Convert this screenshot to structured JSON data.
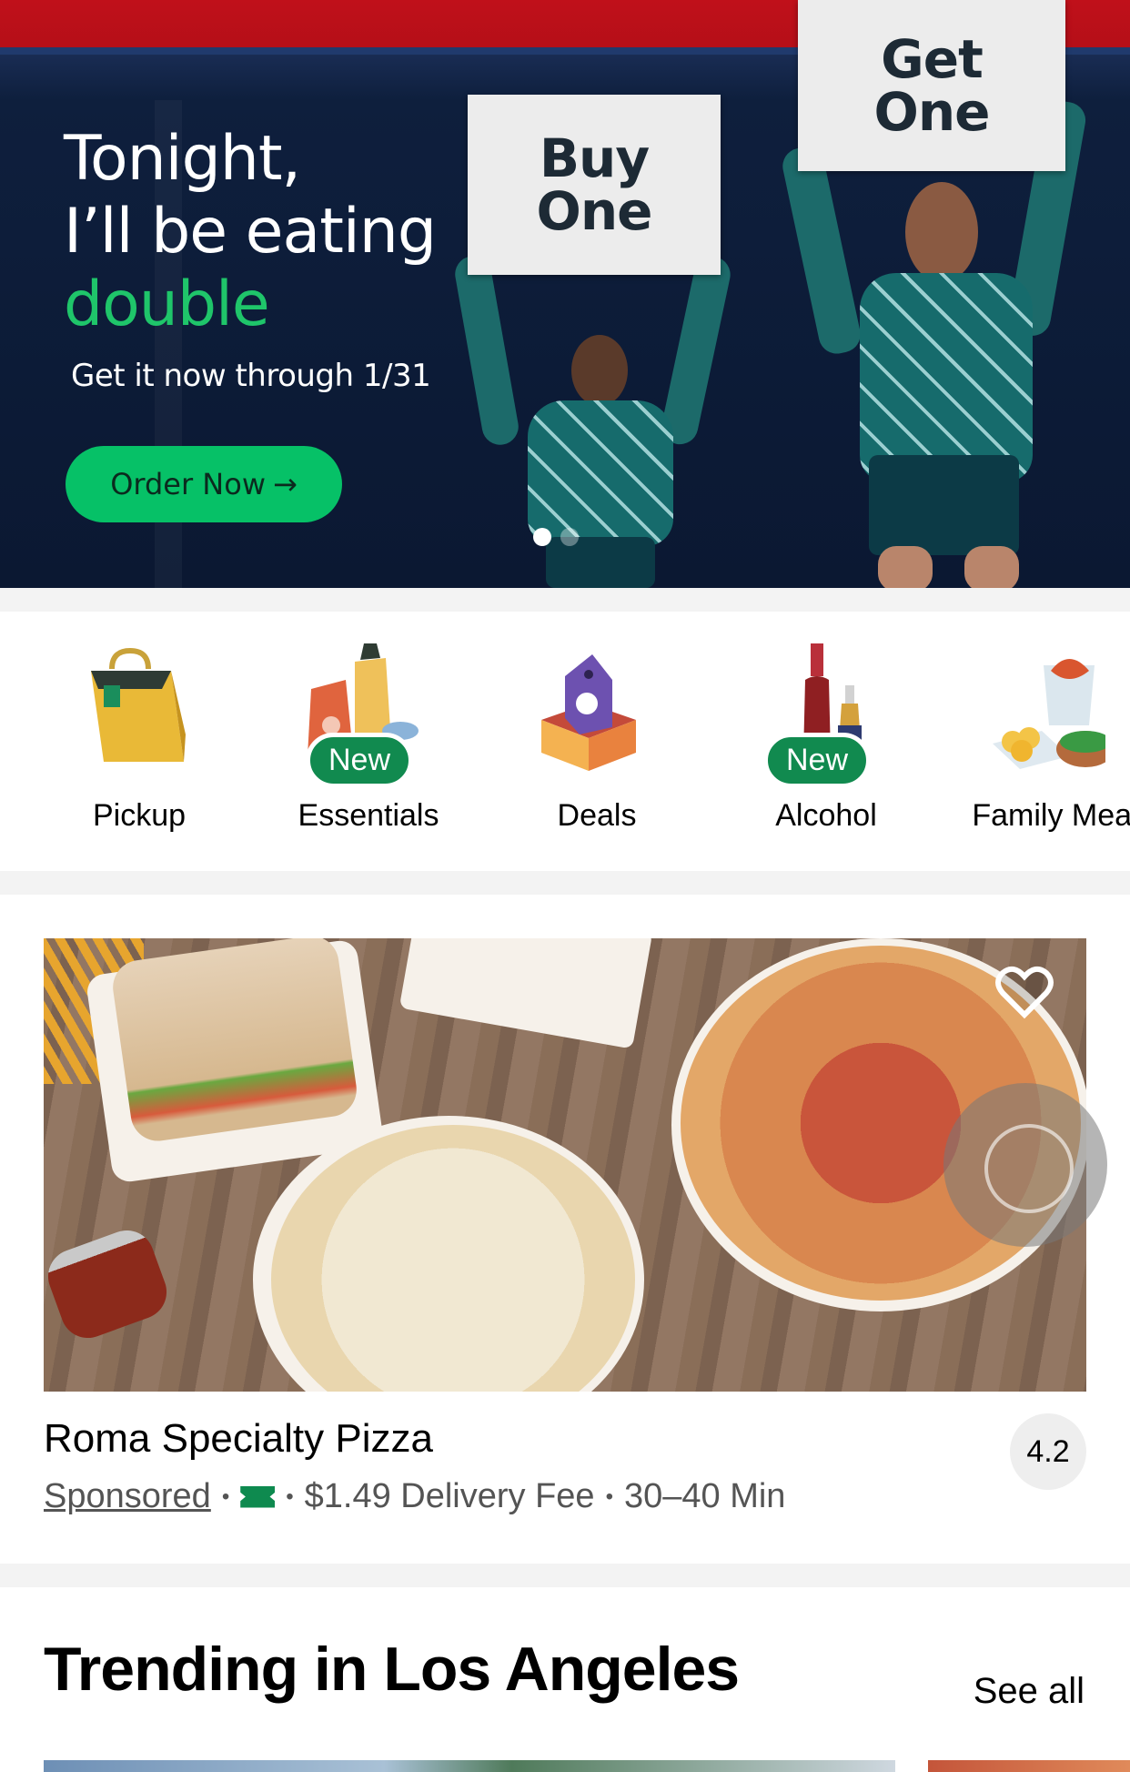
{
  "hero": {
    "line1": "Tonight,",
    "line2": "I’ll be eating",
    "line3": "double",
    "subtitle": "Get it now through 1/31",
    "button_label": "Order Now",
    "button_arrow": "→",
    "sign_left": [
      "Buy",
      "One"
    ],
    "sign_right": [
      "Get",
      "One"
    ],
    "carousel_pages": 2,
    "carousel_active": 1,
    "accent_color": "#06c167"
  },
  "categories": [
    {
      "label": "Pickup",
      "icon": "shopping-bag-icon",
      "badge": ""
    },
    {
      "label": "Essentials",
      "icon": "essentials-icon",
      "badge": "New"
    },
    {
      "label": "Deals",
      "icon": "deals-tag-icon",
      "badge": ""
    },
    {
      "label": "Alcohol",
      "icon": "wine-bottle-icon",
      "badge": "New"
    },
    {
      "label": "Family Meal",
      "icon": "family-meal-icon",
      "badge": ""
    }
  ],
  "restaurant": {
    "name": "Roma Specialty Pizza",
    "sponsored": "Sponsored",
    "offer_icon": "ticket-icon",
    "delivery_fee": "$1.49 Delivery Fee",
    "eta": "30–40 Min",
    "rating": "4.2",
    "separator": "•",
    "favorite_icon": "heart-icon"
  },
  "trending": {
    "title": "Trending in Los Angeles",
    "see_all": "See all"
  }
}
